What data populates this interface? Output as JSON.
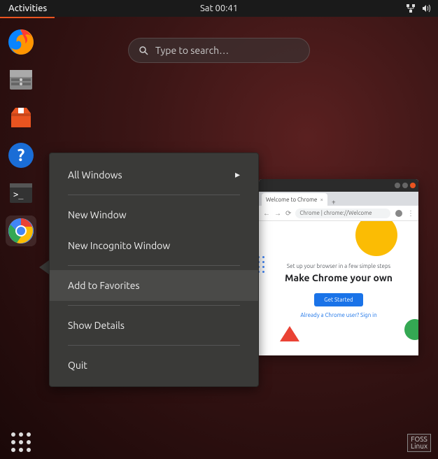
{
  "topbar": {
    "activities": "Activities",
    "clock": "Sat 00:41"
  },
  "search": {
    "placeholder": "Type to search…"
  },
  "dock": {
    "items": [
      {
        "name": "firefox"
      },
      {
        "name": "files"
      },
      {
        "name": "software-center"
      },
      {
        "name": "help"
      },
      {
        "name": "terminal"
      },
      {
        "name": "chrome"
      }
    ]
  },
  "context_menu": {
    "all_windows": "All Windows",
    "new_window": "New Window",
    "new_incognito": "New Incognito Window",
    "add_favorites": "Add to Favorites",
    "show_details": "Show Details",
    "quit": "Quit"
  },
  "chrome": {
    "tab_title": "Welcome to Chrome",
    "address": "Chrome | chrome://Welcome",
    "subtitle": "Set up your browser in a few simple steps",
    "heading": "Make Chrome your own",
    "button": "Get Started",
    "signin_link": "Already a Chrome user? Sign in"
  },
  "watermark": {
    "line1": "FOSS",
    "line2": "Linux"
  },
  "colors": {
    "ubuntu_orange": "#e95420",
    "google_blue": "#1a73e8"
  }
}
